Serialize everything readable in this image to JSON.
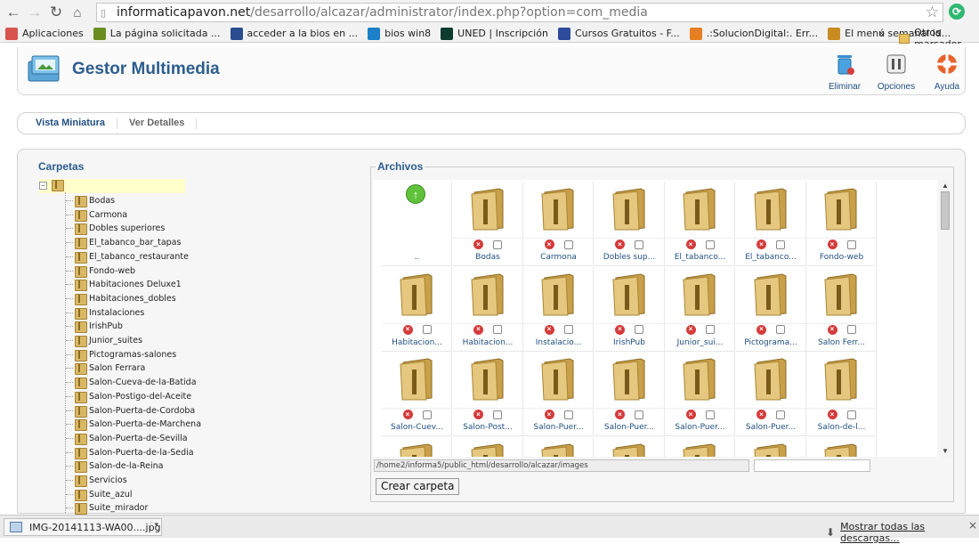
{
  "browser": {
    "url_host": "informaticapavon.net",
    "url_path": "/desarrollo/alcazar/administrator/index.php?option=com_media",
    "bookmarks": [
      {
        "label": "Aplicaciones",
        "icon": "apps-grid-icon",
        "color": "#d9534f"
      },
      {
        "label": "La página solicitada ...",
        "icon": "bookmark-page-icon",
        "color": "#6b8e23"
      },
      {
        "label": "acceder a la bios en ...",
        "icon": "ti-icon",
        "color": "#2a4d8f"
      },
      {
        "label": "bios win8",
        "icon": "hp-icon",
        "color": "#1b7fc9"
      },
      {
        "label": "UNED | Inscripción",
        "icon": "uned-icon",
        "color": "#0d3b2e"
      },
      {
        "label": "Cursos Gratuitos - F...",
        "icon": "cursos-icon",
        "color": "#2d4a9c"
      },
      {
        "label": ".:SolucionDigital:. Err...",
        "icon": "solucion-icon",
        "color": "#e67e22"
      },
      {
        "label": "El menú semanal id...",
        "icon": "rtve-icon",
        "color": "#c98a1f"
      }
    ],
    "more": "»",
    "other_bookmarks": "Otros marcador"
  },
  "header": {
    "title": "Gestor Multimedia",
    "tools": [
      {
        "label": "Eliminar",
        "icon": "trash-icon"
      },
      {
        "label": "Opciones",
        "icon": "options-icon"
      },
      {
        "label": "Ayuda",
        "icon": "help-lifebuoy-icon"
      }
    ]
  },
  "tabs": [
    {
      "label": "Vista Miniatura",
      "active": true
    },
    {
      "label": "Ver Detalles",
      "active": false
    }
  ],
  "folders": {
    "title": "Carpetas",
    "items": [
      "Bodas",
      "Carmona",
      "Dobles superiores",
      "El_tabanco_bar_tapas",
      "El_tabanco_restaurante",
      "Fondo-web",
      "Habitaciones Deluxe1",
      "Habitaciones_dobles",
      "Instalaciones",
      "IrishPub",
      "Junior_suites",
      "Pictogramas-salones",
      "Salon Ferrara",
      "Salon-Cueva-de-la-Batida",
      "Salon-Postigo-del-Aceite",
      "Salon-Puerta-de-Cordoba",
      "Salon-Puerta-de-Marchena",
      "Salon-Puerta-de-Sevilla",
      "Salon-Puerta-de-la-Sedia",
      "Salon-de-la-Reina",
      "Servicios",
      "Suite_azul",
      "Suite_mirador"
    ]
  },
  "files": {
    "title": "Archivos",
    "up_label": "..",
    "items": [
      "Bodas",
      "Carmona",
      "Dobles sup...",
      "El_tabanco...",
      "El_tabanco...",
      "Fondo-web",
      "Habitacion...",
      "Habitacion...",
      "Instalacio...",
      "IrishPub",
      "Junior_sui...",
      "Pictograma...",
      "Salon Ferr...",
      "Salon-Cuev...",
      "Salon-Post...",
      "Salon-Puer...",
      "Salon-Puer...",
      "Salon-Puer...",
      "Salon-Puer...",
      "Salon-de-l..."
    ],
    "path": "/home2/informa5/public_html/desarrollo/alcazar/images",
    "new_folder_value": "",
    "create_button": "Crear carpeta"
  },
  "downloads": {
    "file": "IMG-20141113-WA00....jpg",
    "show_all": "Mostrar todas las descargas...",
    "close": "×"
  }
}
